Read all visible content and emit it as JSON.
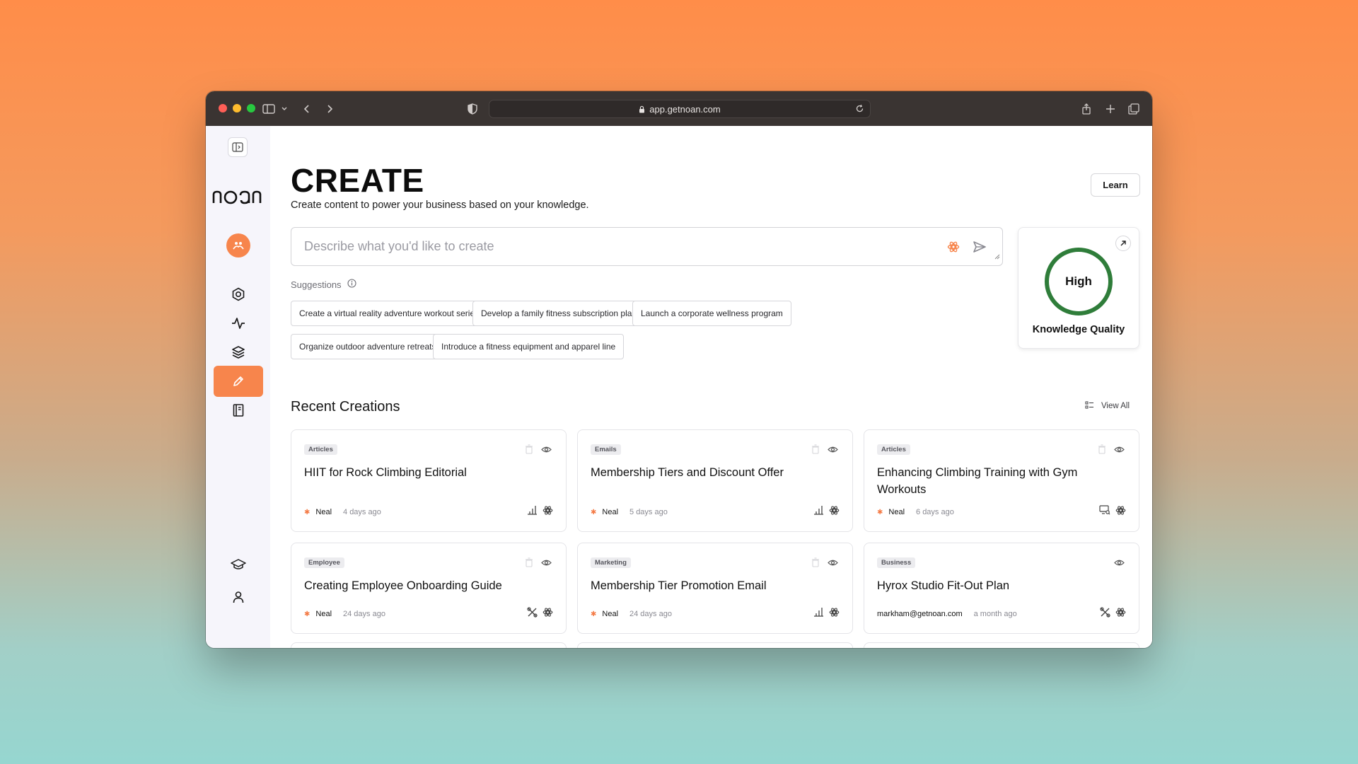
{
  "browser": {
    "url": "app.getnoan.com"
  },
  "sidebar": {
    "logo_text": "noan",
    "items": [
      "avatar",
      "settings",
      "activity",
      "knowledge",
      "create",
      "library",
      "learn",
      "account"
    ],
    "active": "create",
    "accent": "#f7854c"
  },
  "header": {
    "title": "CREATE",
    "subtitle": "Create content to power your business based on your knowledge.",
    "learn_label": "Learn"
  },
  "prompt": {
    "placeholder": "Describe what you'd like to create",
    "value": ""
  },
  "suggestions": {
    "label": "Suggestions",
    "items": [
      "Create a virtual reality adventure workout series",
      "Develop a family fitness subscription plan",
      "Launch a corporate wellness program",
      "Organize outdoor adventure retreats",
      "Introduce a fitness equipment and apparel line"
    ]
  },
  "knowledge_quality": {
    "level": "High",
    "label": "Knowledge Quality",
    "color": "#2f7d3a"
  },
  "recent": {
    "title": "Recent Creations",
    "view_all": "View All",
    "cards": [
      {
        "category": "Articles",
        "title": "HIIT for Rock Climbing Editorial",
        "user": "Neal",
        "time": "4 days ago"
      },
      {
        "category": "Emails",
        "title": "Membership Tiers and Discount Offer",
        "user": "Neal",
        "time": "5 days ago"
      },
      {
        "category": "Articles",
        "title": "Enhancing Climbing Training with Gym Workouts",
        "user": "Neal",
        "time": "6 days ago"
      },
      {
        "category": "Employee",
        "title": "Creating Employee Onboarding Guide",
        "user": "Neal",
        "time": "24 days ago"
      },
      {
        "category": "Marketing",
        "title": "Membership Tier Promotion Email",
        "user": "Neal",
        "time": "24 days ago"
      },
      {
        "category": "Business",
        "title": "Hyrox Studio Fit-Out Plan",
        "user": "markham@getnoan.com",
        "time": "a month ago"
      }
    ]
  }
}
